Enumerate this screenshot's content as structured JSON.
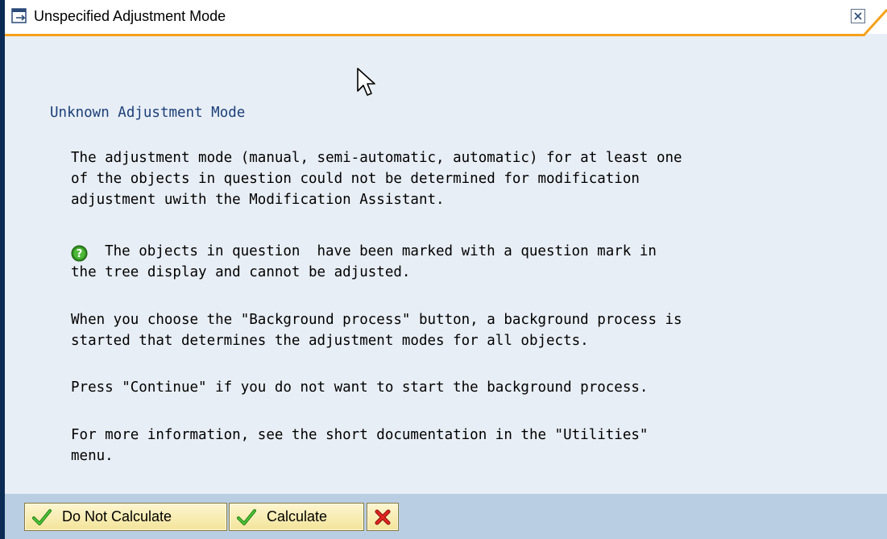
{
  "window": {
    "title": "Unspecified Adjustment Mode",
    "close_icon": "close-icon"
  },
  "message": {
    "heading": "Unknown Adjustment Mode",
    "paragraph1": "The adjustment mode (manual, semi-automatic, automatic) for at least one\nof the objects in question could not be determined for modification\nadjustment uwith the Modification Assistant.",
    "paragraph2_line1": "  The objects in question  have been marked with a question mark in",
    "paragraph2_line2": "the tree display and cannot be adjusted.",
    "paragraph3": "When you choose the \"Background process\" button, a background process is\nstarted that determines the adjustment modes for all objects.",
    "paragraph4": "Press \"Continue\" if you do not want to start the background process.",
    "paragraph5": "For more information, see the short documentation in the \"Utilities\"\nmenu."
  },
  "buttons": {
    "do_not_calculate": "Do Not Calculate",
    "calculate": "Calculate",
    "cancel_icon": "cancel-icon"
  },
  "colors": {
    "accent_orange": "#f5a11a",
    "heading_blue": "#1a3f7a",
    "content_bg": "#e8eef5",
    "footer_bg": "#b9cde3",
    "button_bg": "#f3e49a"
  }
}
